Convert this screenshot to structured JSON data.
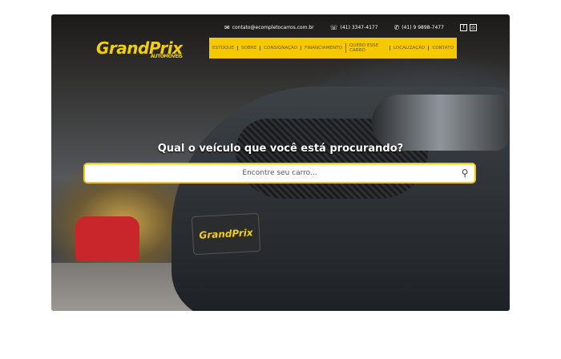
{
  "brand": {
    "name": "GrandPrix",
    "sub": "AUTOMÓVEIS"
  },
  "contact": {
    "email": "contato@ecompletocarros.com.br",
    "phone": "(41) 3347-4177",
    "whatsapp": "(41) 9 9898-7477"
  },
  "social": [
    "facebook-icon",
    "instagram-icon"
  ],
  "nav": [
    "ESTOQUE",
    "SOBRE",
    "CONSIGNAÇÃO",
    "FINANCIAMENTO",
    "QUERO ESSE CARRO",
    "LOCALIZAÇÃO",
    "CONTATO"
  ],
  "hero": {
    "title": "Qual o veículo que você está procurando?",
    "search_placeholder": "Encontre seu carro..."
  },
  "colors": {
    "accent": "#f5c800"
  }
}
